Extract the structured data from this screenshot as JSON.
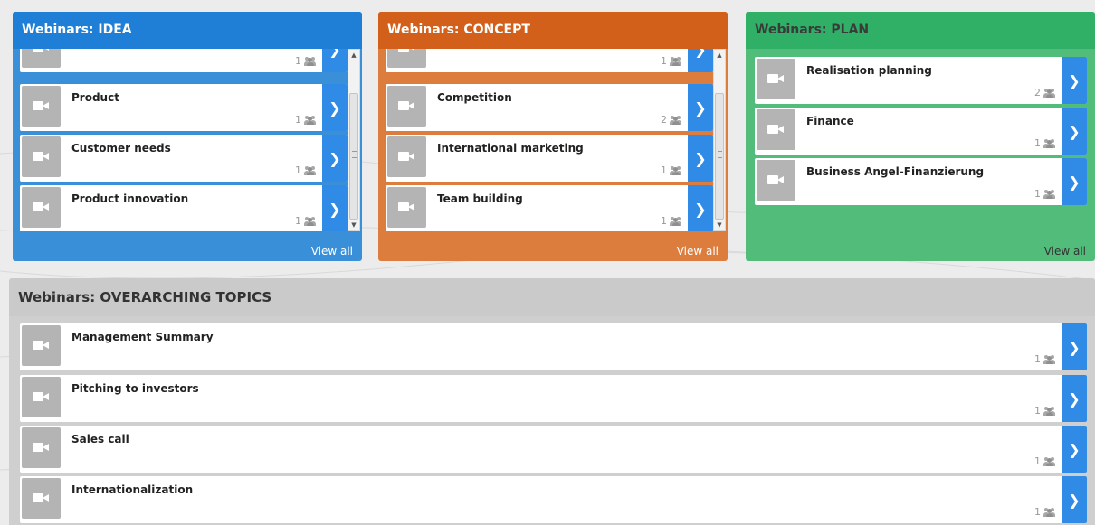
{
  "panels": {
    "idea": {
      "title": "Webinars: IDEA",
      "view_all": "View all",
      "items": [
        {
          "title": "",
          "count": "1"
        },
        {
          "title": "Product",
          "count": "1"
        },
        {
          "title": "Customer needs",
          "count": "1"
        },
        {
          "title": "Product innovation",
          "count": "1"
        }
      ]
    },
    "concept": {
      "title": "Webinars: CONCEPT",
      "view_all": "View all",
      "items": [
        {
          "title": "",
          "count": "1"
        },
        {
          "title": "Competition",
          "count": "2"
        },
        {
          "title": "International marketing",
          "count": "1"
        },
        {
          "title": "Team building",
          "count": "1"
        }
      ]
    },
    "plan": {
      "title": "Webinars: PLAN",
      "view_all": "View all",
      "items": [
        {
          "title": "Realisation planning",
          "count": "2"
        },
        {
          "title": "Finance",
          "count": "1"
        },
        {
          "title": "Business Angel-Finanzierung",
          "count": "1"
        }
      ]
    },
    "overarching": {
      "title": "Webinars: OVERARCHING TOPICS",
      "items": [
        {
          "title": "Management Summary",
          "count": "1"
        },
        {
          "title": "Pitching to investors",
          "count": "1"
        },
        {
          "title": "Sales call",
          "count": "1"
        },
        {
          "title": "Internationalization",
          "count": "1"
        }
      ]
    }
  },
  "icons": {
    "thumbnail": "video-camera-icon",
    "participants": "people-group-icon",
    "open": "chevron-right-icon"
  },
  "colors": {
    "idea": "#1f7fd6",
    "concept": "#d2601a",
    "plan": "#2fb066",
    "overarching": "#cacaca",
    "arrow": "#2f8be6"
  }
}
